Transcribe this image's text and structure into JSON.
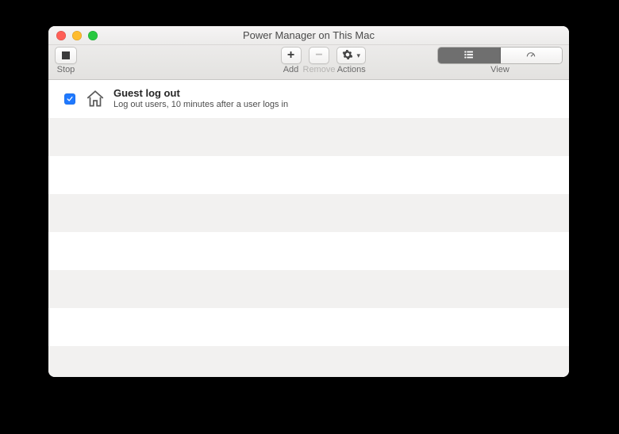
{
  "window": {
    "title": "Power Manager on This Mac"
  },
  "toolbar": {
    "stop_label": "Stop",
    "add_label": "Add",
    "remove_label": "Remove",
    "actions_label": "Actions",
    "view_label": "View"
  },
  "events": [
    {
      "enabled": true,
      "icon": "home-icon",
      "title": "Guest log out",
      "subtitle": "Log out users, 10 minutes after a user logs in"
    }
  ]
}
